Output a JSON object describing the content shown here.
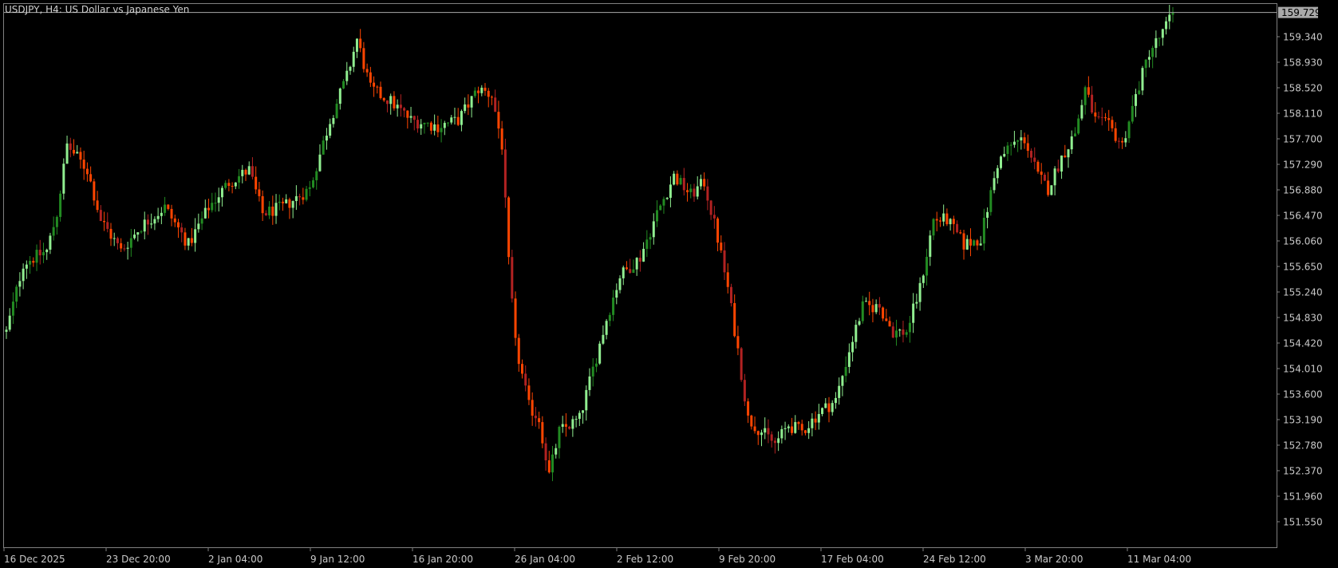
{
  "window": {
    "title": "USDJPY, H4:  US Dollar vs Japanese Yen"
  },
  "chart_data": {
    "type": "candlestick",
    "symbol": "USDJPY",
    "timeframe": "H4",
    "description": "US Dollar vs Japanese Yen",
    "current_price": "159.729",
    "y_axis_labels": [
      "159.340",
      "158.930",
      "158.520",
      "158.110",
      "157.700",
      "157.290",
      "156.880",
      "156.470",
      "156.060",
      "155.650",
      "155.240",
      "154.830",
      "154.420",
      "154.010",
      "153.600",
      "153.190",
      "152.780",
      "152.370",
      "151.960",
      "151.550"
    ],
    "x_axis_labels": [
      "16 Dec 2025",
      "23 Dec 20:00",
      "2 Jan 04:00",
      "9 Jan 12:00",
      "16 Jan 20:00",
      "26 Jan 04:00",
      "2 Feb 12:00",
      "9 Feb 20:00",
      "17 Feb 04:00",
      "24 Feb 12:00",
      "3 Mar 20:00",
      "11 Mar 04:00"
    ],
    "ylim": [
      151.2,
      159.85
    ],
    "grid": false,
    "colors": {
      "background": "#000000",
      "text": "#c8c8c8",
      "axis_line": "#808080",
      "bull_bright": "#90ee90",
      "bull_dark": "#228b22",
      "bear_bright": "#ff4500",
      "bear_dark": "#b22222",
      "price_line": "#a9a9a9",
      "price_tag_bg": "#a9a9a9",
      "price_tag_text": "#000000"
    },
    "path_anchors": [
      [
        0,
        154.6
      ],
      [
        5,
        155.7
      ],
      [
        12,
        155.9
      ],
      [
        15,
        156.5
      ],
      [
        18,
        157.6
      ],
      [
        24,
        157.2
      ],
      [
        28,
        156.4
      ],
      [
        34,
        155.9
      ],
      [
        40,
        156.3
      ],
      [
        47,
        156.6
      ],
      [
        54,
        156.0
      ],
      [
        60,
        156.6
      ],
      [
        66,
        157.0
      ],
      [
        72,
        157.2
      ],
      [
        76,
        156.5
      ],
      [
        82,
        156.6
      ],
      [
        90,
        156.9
      ],
      [
        96,
        158.0
      ],
      [
        101,
        158.7
      ],
      [
        104,
        159.3
      ],
      [
        108,
        158.5
      ],
      [
        114,
        158.3
      ],
      [
        120,
        158.0
      ],
      [
        128,
        157.9
      ],
      [
        134,
        158.0
      ],
      [
        140,
        158.5
      ],
      [
        144,
        158.4
      ],
      [
        147,
        157.6
      ],
      [
        149,
        155.7
      ],
      [
        151,
        154.4
      ],
      [
        155,
        153.4
      ],
      [
        158,
        153.2
      ],
      [
        161,
        152.3
      ],
      [
        164,
        153.0
      ],
      [
        170,
        153.2
      ],
      [
        174,
        154.0
      ],
      [
        178,
        154.8
      ],
      [
        182,
        155.5
      ],
      [
        188,
        155.8
      ],
      [
        193,
        156.5
      ],
      [
        198,
        157.1
      ],
      [
        203,
        156.8
      ],
      [
        207,
        157.0
      ],
      [
        211,
        156.1
      ],
      [
        214,
        155.3
      ],
      [
        217,
        154.3
      ],
      [
        220,
        153.2
      ],
      [
        224,
        153.0
      ],
      [
        228,
        152.8
      ],
      [
        232,
        153.1
      ],
      [
        236,
        153.0
      ],
      [
        241,
        153.3
      ],
      [
        246,
        153.5
      ],
      [
        250,
        154.3
      ],
      [
        254,
        155.0
      ],
      [
        259,
        155.0
      ],
      [
        263,
        154.6
      ],
      [
        267,
        154.6
      ],
      [
        271,
        155.3
      ],
      [
        275,
        156.4
      ],
      [
        279,
        156.4
      ],
      [
        284,
        156.0
      ],
      [
        289,
        156.1
      ],
      [
        294,
        157.3
      ],
      [
        298,
        157.6
      ],
      [
        302,
        157.7
      ],
      [
        306,
        157.1
      ],
      [
        309,
        156.9
      ],
      [
        313,
        157.4
      ],
      [
        317,
        157.8
      ],
      [
        320,
        158.5
      ],
      [
        323,
        158.0
      ],
      [
        327,
        157.9
      ],
      [
        331,
        157.6
      ],
      [
        334,
        158.2
      ],
      [
        339,
        159.1
      ],
      [
        343,
        159.4
      ],
      [
        346,
        159.73
      ]
    ]
  }
}
